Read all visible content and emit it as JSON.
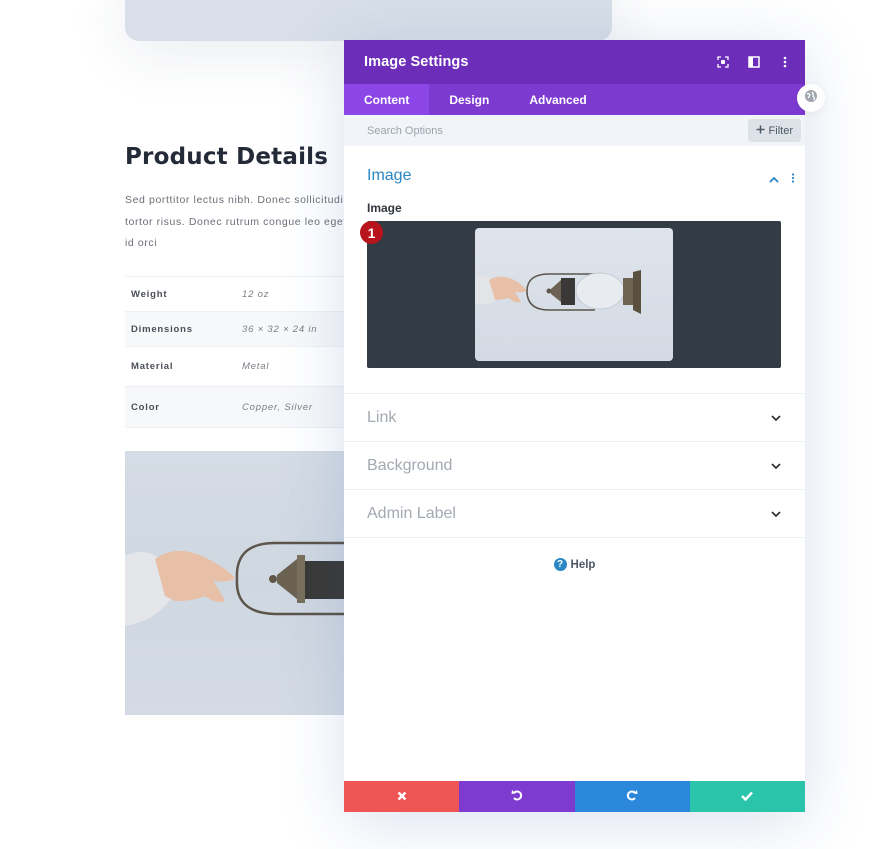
{
  "page": {
    "title": "Product Details",
    "description_lines": [
      "Sed porttitor lectus nibh. Donec sollicitudin",
      "tortor risus. Donec rutrum congue leo eget",
      "id orci"
    ],
    "specs": [
      {
        "label": "Weight",
        "value": "12 oz"
      },
      {
        "label": "Dimensions",
        "value": "36 × 32 × 24 in"
      },
      {
        "label": "Material",
        "value": "Metal"
      },
      {
        "label": "Color",
        "value": "Copper, Silver"
      }
    ]
  },
  "modal": {
    "title": "Image Settings",
    "header_icons": [
      "focus-mode-icon",
      "split-view-icon",
      "more-options-icon"
    ],
    "tabs": [
      {
        "label": "Content",
        "active": true
      },
      {
        "label": "Design",
        "active": false
      },
      {
        "label": "Advanced",
        "active": false
      }
    ],
    "search": {
      "placeholder": "Search Options",
      "value": ""
    },
    "filter_label": "Filter",
    "open_section": {
      "title": "Image",
      "field_label": "Image",
      "badge": "1"
    },
    "sections": [
      {
        "title": "Link"
      },
      {
        "title": "Background"
      },
      {
        "title": "Admin Label"
      }
    ],
    "help_label": "Help",
    "footer": {
      "cancel": "cancel-icon",
      "undo": "undo-icon",
      "redo": "redo-icon",
      "save": "check-icon"
    },
    "colors": {
      "header": "#6c2eb9",
      "tabs": "#7d3ad1",
      "active_tab": "#8c45e6",
      "accent_blue": "#2b87c4",
      "cancel": "#ef5555",
      "undo": "#7e3bd0",
      "redo": "#2b87da",
      "save": "#29c4a9"
    }
  }
}
